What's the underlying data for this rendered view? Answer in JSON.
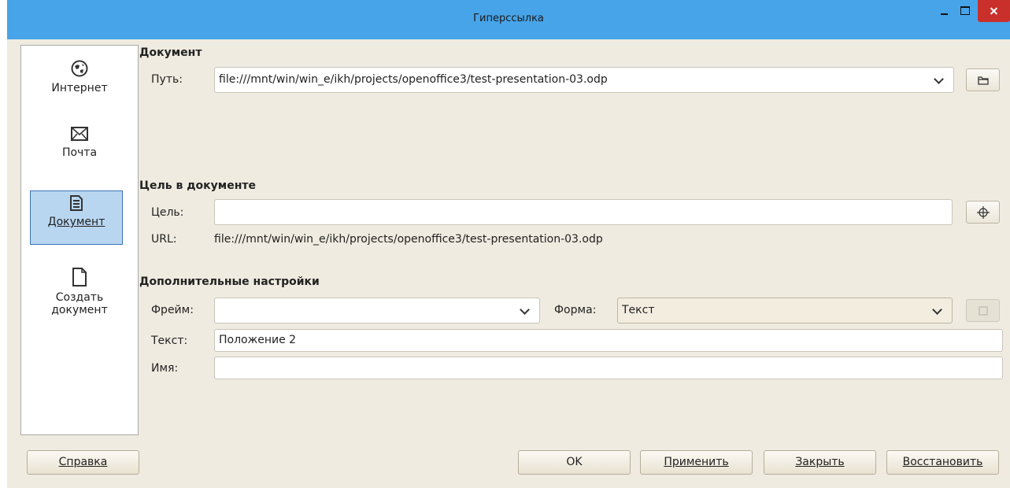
{
  "window": {
    "title": "Гиперссылка"
  },
  "sidebar": {
    "items": [
      {
        "label": "Интернет",
        "icon": "globe-icon"
      },
      {
        "label": "Почта",
        "icon": "envelope-icon"
      },
      {
        "label": "Документ",
        "icon": "document-icon"
      },
      {
        "label": "Создать\nдокумент",
        "icon": "new-document-icon"
      }
    ]
  },
  "document": {
    "heading": "Документ",
    "path_label": "Путь:",
    "path_value": "file:///mnt/win/win_e/ikh/projects/openoffice3/test-presentation-03.odp"
  },
  "target": {
    "heading": "Цель в документе",
    "target_label": "Цель:",
    "target_value": "",
    "url_label": "URL:",
    "url_value": "file:///mnt/win/win_e/ikh/projects/openoffice3/test-presentation-03.odp"
  },
  "extra": {
    "heading": "Дополнительные настройки",
    "frame_label": "Фрейм:",
    "frame_value": "",
    "form_label": "Форма:",
    "form_value": "Текст",
    "text_label": "Текст:",
    "text_value": "Положение 2",
    "name_label": "Имя:",
    "name_value": ""
  },
  "buttons": {
    "help": "Справка",
    "ok": "OK",
    "apply": "Применить",
    "close": "Закрыть",
    "reset": "Восстановить"
  },
  "colors": {
    "titlebar": "#47a4e8",
    "dialog_bg": "#efebe0",
    "active_item": "#b8d6f0",
    "close_button": "#c9302c"
  }
}
